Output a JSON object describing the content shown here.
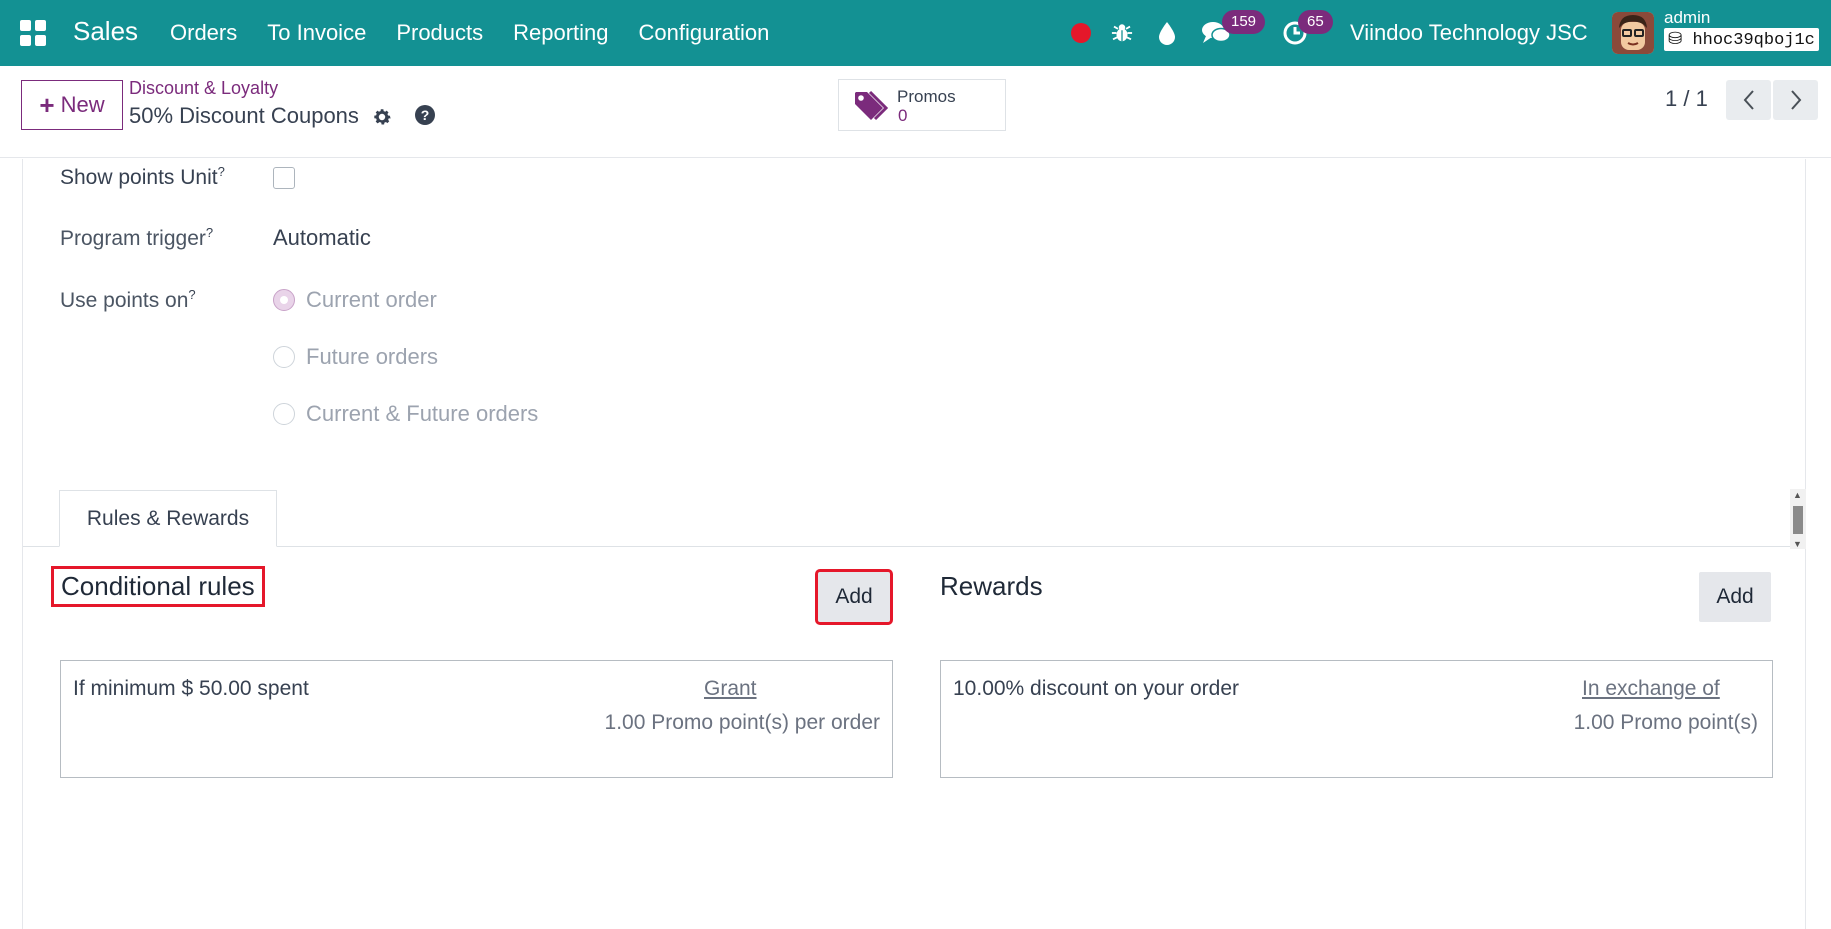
{
  "navbar": {
    "app_name": "Sales",
    "menu": [
      "Orders",
      "To Invoice",
      "Products",
      "Reporting",
      "Configuration"
    ],
    "messages_count": "159",
    "activities_count": "65",
    "company": "Viindoo Technology JSC",
    "user": "admin",
    "database": "hhoc39qboj1c",
    "colors": {
      "bar": "#139193",
      "badge": "#7b2b7c",
      "record": "#e5172a"
    }
  },
  "control_panel": {
    "new_button": "New",
    "breadcrumb": "Discount & Loyalty",
    "record_title": "50% Discount Coupons",
    "smart_button": {
      "label": "Promos",
      "value": "0"
    },
    "pager": "1 / 1"
  },
  "form": {
    "fields": {
      "show_points_unit": {
        "label": "Show points Unit",
        "help": "?",
        "checked": false
      },
      "program_trigger": {
        "label": "Program trigger",
        "help": "?",
        "value": "Automatic"
      },
      "use_points_on": {
        "label": "Use points on",
        "help": "?",
        "options": [
          "Current order",
          "Future orders",
          "Current & Future orders"
        ],
        "selected": "Current order"
      }
    },
    "tabs": [
      "Rules & Rewards"
    ],
    "conditional_rules": {
      "title": "Conditional rules",
      "add_label": "Add",
      "cards": [
        {
          "condition": "If minimum $ 50.00 spent",
          "link": "Grant",
          "detail": "1.00 Promo point(s) per order"
        }
      ]
    },
    "rewards": {
      "title": "Rewards",
      "add_label": "Add",
      "cards": [
        {
          "reward": "10.00% discount on your order",
          "link": "In exchange of",
          "detail": "1.00 Promo point(s)"
        }
      ]
    }
  }
}
